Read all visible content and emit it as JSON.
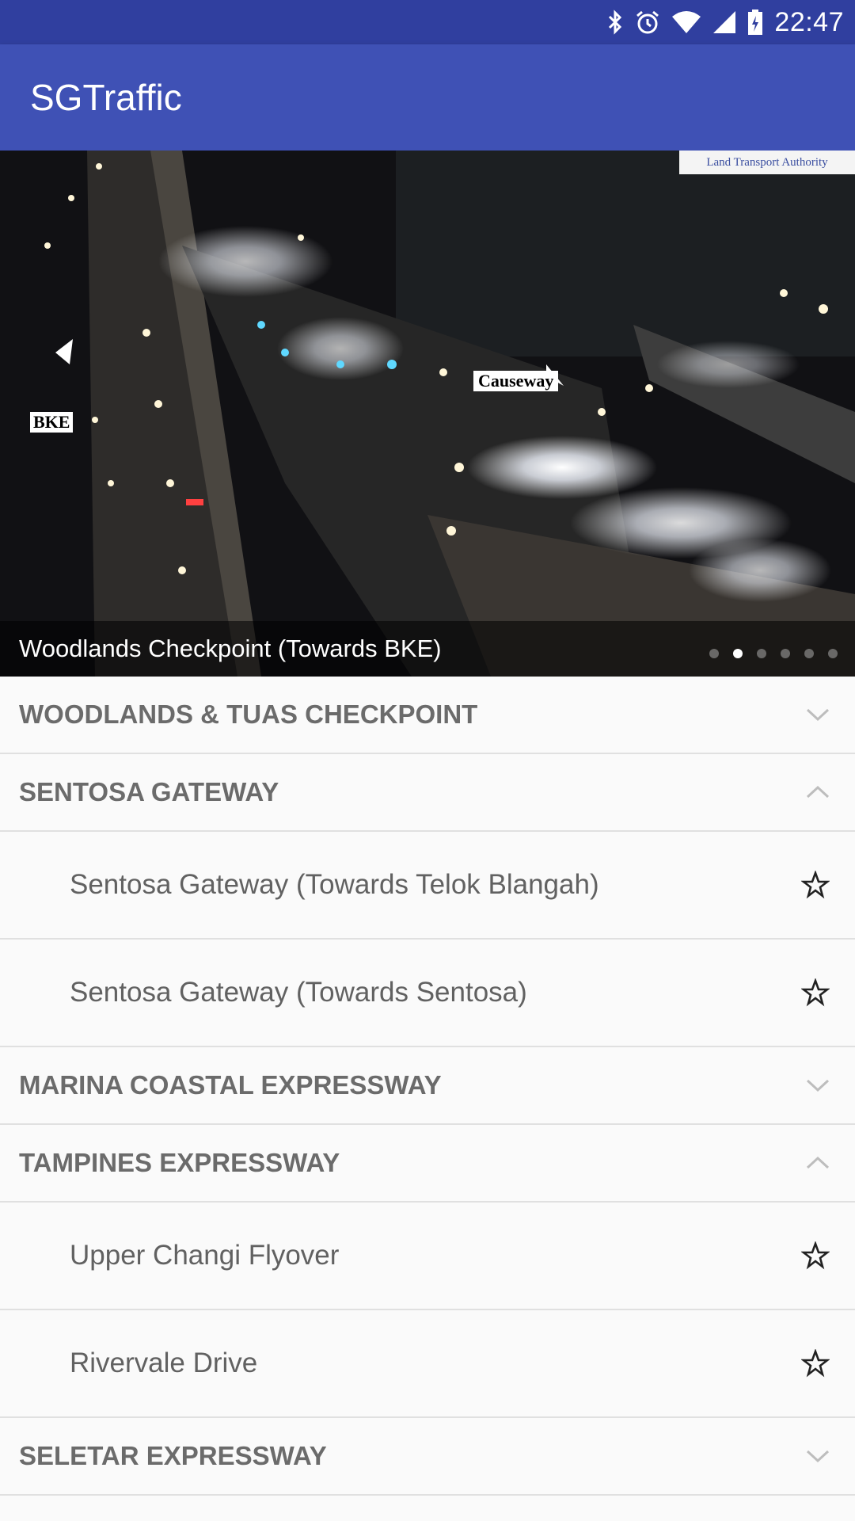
{
  "status_bar": {
    "time": "22:47",
    "icons": [
      "bluetooth-icon",
      "alarm-icon",
      "wifi-icon",
      "signal-icon",
      "battery-charging-icon"
    ]
  },
  "app_bar": {
    "title": "SGTraffic"
  },
  "camera": {
    "caption": "Woodlands Checkpoint (Towards BKE)",
    "logo_text": "Land Transport Authority",
    "signs": {
      "bke": "BKE",
      "causeway": "Causeway"
    },
    "pager": {
      "count": 6,
      "active_index": 1
    }
  },
  "groups": [
    {
      "label": "WOODLANDS & TUAS CHECKPOINT",
      "expanded": false,
      "items": []
    },
    {
      "label": "SENTOSA GATEWAY",
      "expanded": true,
      "items": [
        "Sentosa Gateway (Towards Telok Blangah)",
        "Sentosa Gateway (Towards Sentosa)"
      ]
    },
    {
      "label": "MARINA COASTAL EXPRESSWAY",
      "expanded": false,
      "items": []
    },
    {
      "label": "TAMPINES EXPRESSWAY",
      "expanded": true,
      "items": [
        "Upper Changi Flyover",
        "Rivervale Drive"
      ]
    },
    {
      "label": "SELETAR EXPRESSWAY",
      "expanded": false,
      "items": []
    }
  ],
  "colors": {
    "status_bar": "#303f9f",
    "app_bar": "#3f51b5",
    "list_background": "#fafafa",
    "group_label": "#6b6b6b",
    "item_label": "#616161"
  }
}
